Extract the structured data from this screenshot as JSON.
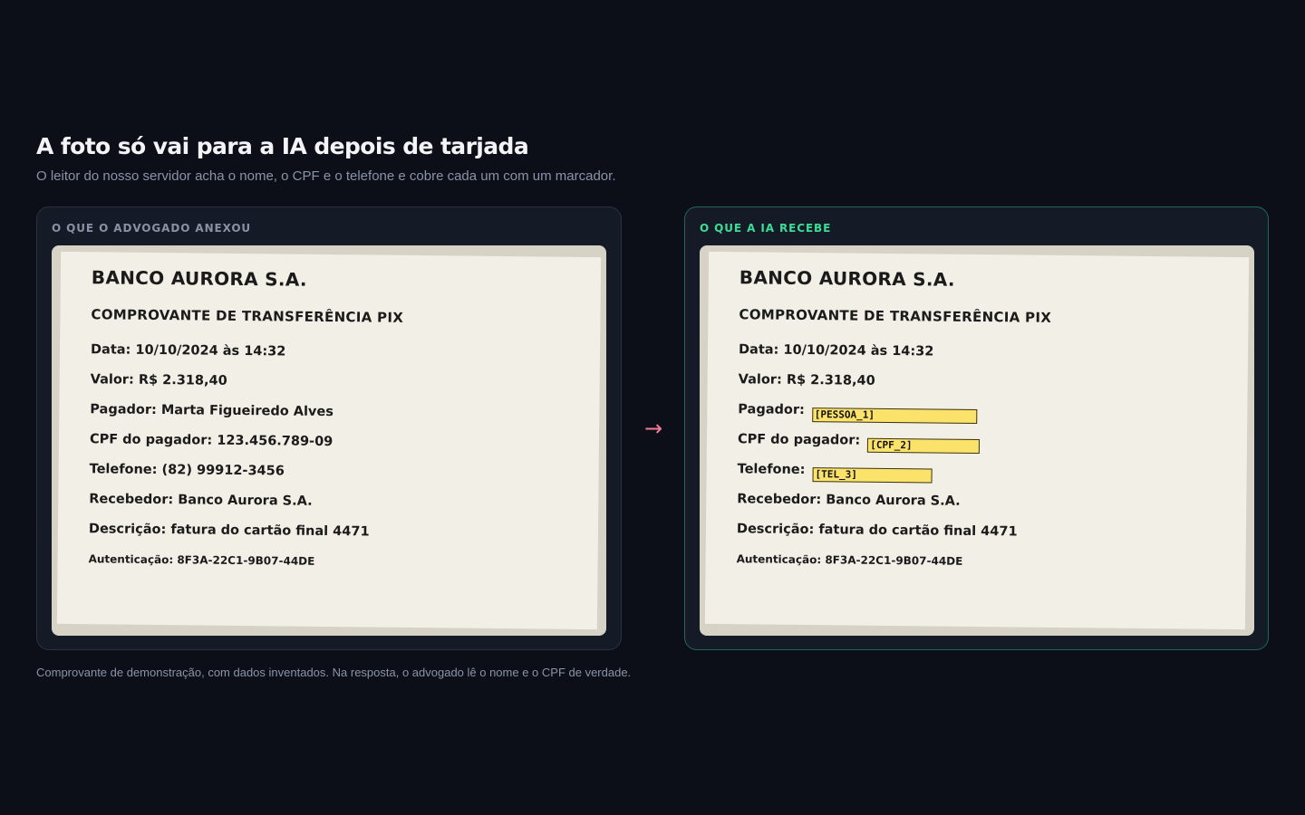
{
  "header": {
    "title": "A foto só vai para a IA depois de tarjada",
    "subtitle": "O leitor do nosso servidor acha o nome, o CPF e o telefone e cobre cada um com um marcador."
  },
  "panels": {
    "original": {
      "label": "O QUE O ADVOGADO ANEXOU",
      "receipt": {
        "bank": "BANCO AURORA S.A.",
        "heading": "COMPROVANTE DE TRANSFERÊNCIA PIX",
        "date_label": "Data:",
        "date_value": "10/10/2024 às 14:32",
        "amount_label": "Valor:",
        "amount_value": "R$ 2.318,40",
        "payer_label": "Pagador:",
        "payer_value": "Marta Figueiredo Alves",
        "cpf_label": "CPF do pagador:",
        "cpf_value": "123.456.789-09",
        "phone_label": "Telefone:",
        "phone_value": "(82) 99912-3456",
        "recipient_label": "Recebedor:",
        "recipient_value": "Banco Aurora S.A.",
        "description_label": "Descrição:",
        "description_value": "fatura do cartão final 4471",
        "auth_label": "Autenticação:",
        "auth_value": "8F3A-22C1-9B07-44DE"
      }
    },
    "redacted": {
      "label": "O QUE A IA RECEBE",
      "receipt": {
        "bank": "BANCO AURORA S.A.",
        "heading": "COMPROVANTE DE TRANSFERÊNCIA PIX",
        "date_label": "Data:",
        "date_value": "10/10/2024 às 14:32",
        "amount_label": "Valor:",
        "amount_value": "R$ 2.318,40",
        "payer_label": "Pagador:",
        "payer_marker": "[PESSOA_1]",
        "cpf_label": "CPF do pagador:",
        "cpf_marker": "[CPF_2]",
        "phone_label": "Telefone:",
        "phone_marker": "[TEL_3]",
        "recipient_label": "Recebedor:",
        "recipient_value": "Banco Aurora S.A.",
        "description_label": "Descrição:",
        "description_value": "fatura do cartão final 4471",
        "auth_label": "Autenticação:",
        "auth_value": "8F3A-22C1-9B07-44DE"
      }
    }
  },
  "arrow": "→",
  "footnote": "Comprovante de demonstração, com dados inventados. Na resposta, o advogado lê o nome e o CPF de verdade.",
  "colors": {
    "background": "#0c0f18",
    "panel": "#151a27",
    "accent_green": "#3ddc97",
    "arrow_pink": "#f47b9a",
    "marker_yellow": "#fbe26a",
    "paper": "#f1efe6"
  }
}
